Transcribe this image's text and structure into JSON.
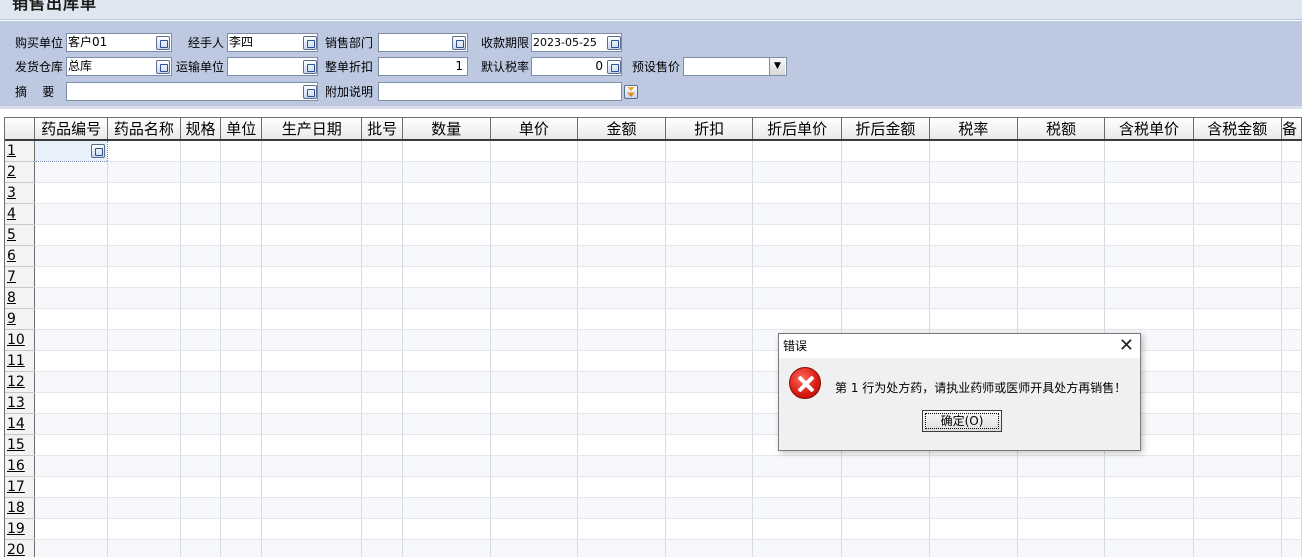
{
  "window": {
    "title": "销售出库单"
  },
  "form": {
    "buyer_label": "购买单位",
    "buyer_value": "客户01",
    "handler_label": "经手人",
    "handler_value": "李四",
    "dept_label": "销售部门",
    "dept_value": "",
    "due_label": "收款期限",
    "due_value": "2023-05-25",
    "warehouse_label": "发货仓库",
    "warehouse_value": "总库",
    "transport_label": "运输单位",
    "transport_value": "",
    "discount_label": "整单折扣",
    "discount_value": "1",
    "taxrate_label": "默认税率",
    "taxrate_value": "0",
    "preset_price_label": "预设售价",
    "preset_price_value": "",
    "summary_label": "摘    要",
    "summary_value": "",
    "note_label": "附加说明",
    "note_value": ""
  },
  "grid": {
    "columns": [
      "药品编号",
      "药品名称",
      "规格",
      "单位",
      "生产日期",
      "批号",
      "数量",
      "单价",
      "金额",
      "折扣",
      "折后单价",
      "折后金额",
      "税率",
      "税额",
      "含税单价",
      "含税金额",
      "备"
    ],
    "row_numbers": [
      "1",
      "2",
      "3",
      "4",
      "5",
      "6",
      "7",
      "8",
      "9",
      "10",
      "11",
      "12",
      "13",
      "14",
      "15",
      "16",
      "17",
      "18",
      "19",
      "20"
    ]
  },
  "dialog": {
    "title": "错误",
    "close": "✕",
    "message": "第 1 行为处方药，请执业药师或医师开具处方再销售！",
    "ok_label": "确定(O)"
  },
  "icons": {
    "dialog_icon": "error-icon",
    "picker_icon": "picker-icon",
    "dropdown_icon": "chevron-down-icon"
  }
}
